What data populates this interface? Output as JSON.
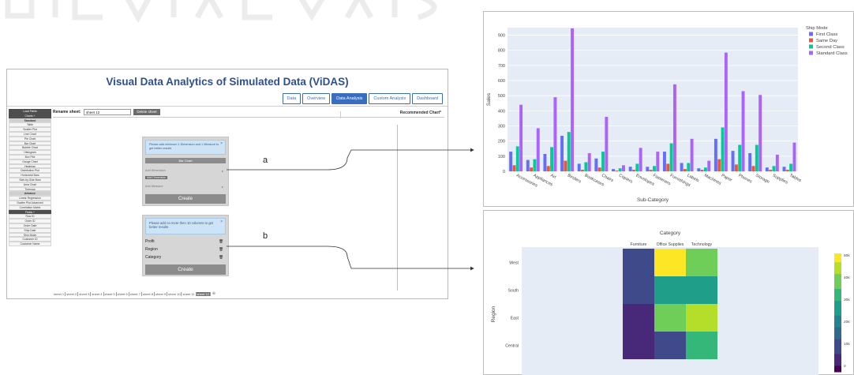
{
  "app": {
    "title": "Visual Data Analytics of Simulated Data (ViDAS)",
    "tabs": [
      {
        "label": "Data",
        "active": false
      },
      {
        "label": "Overview",
        "active": false
      },
      {
        "label": "Data Analysis",
        "active": true
      },
      {
        "label": "Custom Analysis",
        "active": false
      },
      {
        "label": "Dashboard",
        "active": false
      }
    ],
    "rename_label": "Rename sheet:",
    "rename_value": "sheet 12",
    "delete_label": "Delete sheet",
    "recommended_label": "Recommended Chart*"
  },
  "sidebar": {
    "items": [
      {
        "label": "Load Fields",
        "style": "dark"
      },
      {
        "label": "Charts +",
        "style": "dark"
      },
      {
        "label": "Standard",
        "style": "head"
      },
      {
        "label": "Table",
        "style": ""
      },
      {
        "label": "Scatter Plot",
        "style": ""
      },
      {
        "label": "Line Chart",
        "style": ""
      },
      {
        "label": "Pie Chart",
        "style": ""
      },
      {
        "label": "Bar Chart",
        "style": ""
      },
      {
        "label": "Bubble Chart",
        "style": ""
      },
      {
        "label": "Histogram",
        "style": ""
      },
      {
        "label": "Box Plot",
        "style": ""
      },
      {
        "label": "Gauge Chart",
        "style": ""
      },
      {
        "label": "Heatmap",
        "style": ""
      },
      {
        "label": "Distribution Plot",
        "style": ""
      },
      {
        "label": "Horizontal Bars",
        "style": ""
      },
      {
        "label": "Side-by-Side Bars",
        "style": ""
      },
      {
        "label": "Area Chart",
        "style": ""
      },
      {
        "label": "Treemap",
        "style": ""
      },
      {
        "label": "Advance",
        "style": "head"
      },
      {
        "label": "Linear Regression",
        "style": ""
      },
      {
        "label": "Scatter Plot Advanced",
        "style": ""
      },
      {
        "label": "Correlation Matrix",
        "style": ""
      },
      {
        "label": "Fields +",
        "style": "dark"
      },
      {
        "label": "Row ID",
        "style": ""
      },
      {
        "label": "Order ID",
        "style": ""
      },
      {
        "label": "Order Date",
        "style": ""
      },
      {
        "label": "Ship Date",
        "style": ""
      },
      {
        "label": "Ship Mode",
        "style": ""
      },
      {
        "label": "Customer ID",
        "style": ""
      },
      {
        "label": "Customer Name",
        "style": ""
      }
    ]
  },
  "panel_a": {
    "note": "Please add minimum 1 Dimension and 1 Measure to get better results",
    "close": "×",
    "primary_button": "Bar Chart",
    "add_dimension": "Add Dimension",
    "chip": "Add Dimension",
    "add_measure": "Add Measure",
    "create": "Create"
  },
  "panel_b": {
    "note": "Please add no more then 10 columns to get better results",
    "close": "×",
    "fields": [
      "Profit",
      "Region",
      "Category"
    ],
    "create": "Create"
  },
  "sheets": [
    "sheet 1",
    "sheet 2",
    "sheet 3",
    "sheet 4",
    "sheet 5",
    "sheet 6",
    "sheet 7",
    "sheet 8",
    "sheet 9",
    "sheet 10",
    "sheet 11",
    "sheet 12"
  ],
  "active_sheet": "sheet 12",
  "callouts": {
    "a": "a",
    "b": "b"
  },
  "colors": {
    "first_class": "#636efa",
    "same_day": "#ef553b",
    "second_class": "#00cc96",
    "standard_class": "#ab63fa",
    "plot_bg": "#e5ecf6",
    "tab_blue": "#3a6cc0"
  },
  "chart_data": [
    {
      "type": "bar",
      "xlabel": "Sub-Category",
      "ylabel": "Sales",
      "ylim": [
        0,
        950
      ],
      "yticks": [
        0,
        100,
        200,
        300,
        400,
        500,
        600,
        700,
        800,
        900
      ],
      "legend_title": "Ship Mode",
      "legend_position": "top-right",
      "categories": [
        "Accessories",
        "Appliances",
        "Art",
        "Binders",
        "Bookcases",
        "Chairs",
        "Copiers",
        "Envelopes",
        "Fasteners",
        "Furnishings",
        "Labels",
        "Machines",
        "Paper",
        "Phones",
        "Storage",
        "Supplies",
        "Tables"
      ],
      "series": [
        {
          "name": "First Class",
          "values": [
            130,
            75,
            115,
            235,
            50,
            85,
            15,
            30,
            30,
            130,
            55,
            20,
            215,
            135,
            120,
            25,
            30
          ]
        },
        {
          "name": "Same Day",
          "values": [
            40,
            25,
            35,
            70,
            10,
            25,
            5,
            10,
            10,
            50,
            15,
            10,
            80,
            45,
            35,
            10,
            10
          ]
        },
        {
          "name": "Second Class",
          "values": [
            165,
            80,
            160,
            260,
            60,
            130,
            20,
            50,
            35,
            185,
            55,
            25,
            290,
            175,
            175,
            35,
            50
          ]
        },
        {
          "name": "Standard Class",
          "values": [
            440,
            285,
            490,
            945,
            120,
            360,
            40,
            155,
            130,
            575,
            215,
            70,
            785,
            530,
            505,
            110,
            190
          ]
        }
      ]
    },
    {
      "type": "heatmap",
      "title": "Category",
      "ylabel": "Region",
      "x": [
        "Furniture",
        "Office Supplies",
        "Technology"
      ],
      "y": [
        "West",
        "South",
        "East",
        "Central"
      ],
      "z": [
        [
          12000,
          50000,
          40000
        ],
        [
          9000,
          26000,
          26000
        ],
        [
          8000,
          40000,
          45000
        ],
        [
          3000,
          12000,
          32000
        ]
      ],
      "colorbar_ticks": [
        "50k",
        "40k",
        "30k",
        "20k",
        "10k",
        "0"
      ],
      "colorscale": "viridis"
    }
  ]
}
